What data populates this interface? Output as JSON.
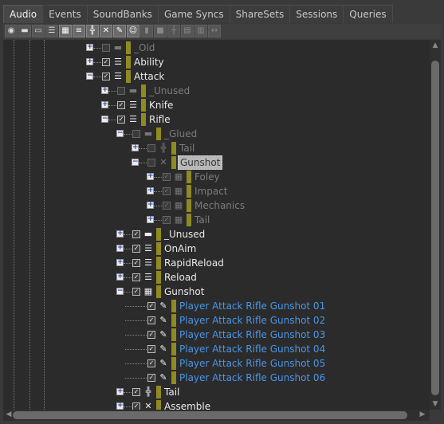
{
  "tabs": [
    {
      "label": "Audio",
      "active": true
    },
    {
      "label": "Events"
    },
    {
      "label": "SoundBanks"
    },
    {
      "label": "Game Syncs"
    },
    {
      "label": "ShareSets"
    },
    {
      "label": "Sessions"
    },
    {
      "label": "Queries"
    }
  ],
  "toolbar": [
    {
      "icon": "work-unit-icon",
      "on": false
    },
    {
      "icon": "folder-icon"
    },
    {
      "icon": "virtual-folder-icon"
    },
    {
      "icon": "actor-mixer-icon"
    },
    {
      "icon": "blend-container-icon",
      "on": true
    },
    {
      "icon": "sequence-container-icon",
      "on": true
    },
    {
      "icon": "switch-container-icon",
      "on": true
    },
    {
      "icon": "random-container-icon",
      "on": true
    },
    {
      "icon": "sound-sfx-icon",
      "on": true
    },
    {
      "icon": "sound-voice-icon",
      "on": true
    },
    {
      "icon": "bus-icon",
      "dim": true
    },
    {
      "icon": "aux-bus-icon",
      "dim": true
    },
    {
      "icon": "music-switch-icon",
      "dim": true
    },
    {
      "icon": "music-playlist-icon",
      "dim": true
    },
    {
      "icon": "music-segment-icon",
      "dim": true
    },
    {
      "icon": "music-track-icon",
      "dim": true
    }
  ],
  "colors": {
    "accent_bar": "#8f8a22",
    "sound_text": "#4a95e8",
    "disabled_text": "#7c7c7c"
  },
  "tree": [
    {
      "level": 0,
      "exp": "+",
      "checked": false,
      "dis": true,
      "icon": "folder-icon",
      "label": "_Old"
    },
    {
      "level": 0,
      "exp": "+",
      "checked": true,
      "icon": "actor-mixer-icon",
      "label": "Ability"
    },
    {
      "level": 0,
      "exp": "-",
      "checked": true,
      "icon": "actor-mixer-icon",
      "label": "Attack"
    },
    {
      "level": 1,
      "exp": "+",
      "checked": false,
      "dis": true,
      "icon": "folder-icon",
      "label": "_Unused"
    },
    {
      "level": 1,
      "exp": "+",
      "checked": true,
      "icon": "actor-mixer-icon",
      "label": "Knife"
    },
    {
      "level": 1,
      "exp": "-",
      "checked": true,
      "icon": "actor-mixer-icon",
      "label": "Rifle"
    },
    {
      "level": 2,
      "exp": "-",
      "checked": false,
      "dis": true,
      "icon": "folder-icon",
      "label": "_Glued"
    },
    {
      "level": 3,
      "exp": "+",
      "checked": false,
      "dis": true,
      "icon": "switch-container-icon",
      "label": "Tail"
    },
    {
      "level": 3,
      "exp": "-",
      "checked": false,
      "dis": true,
      "icon": "random-container-icon",
      "label": "Gunshot",
      "selected": true
    },
    {
      "level": 4,
      "exp": "+",
      "checked": true,
      "dis": true,
      "icon": "blend-container-icon",
      "label": "Foley"
    },
    {
      "level": 4,
      "exp": "+",
      "checked": true,
      "dis": true,
      "icon": "blend-container-icon",
      "label": "Impact"
    },
    {
      "level": 4,
      "exp": "+",
      "checked": true,
      "dis": true,
      "icon": "blend-container-icon",
      "label": "Mechanics"
    },
    {
      "level": 4,
      "exp": "+",
      "checked": true,
      "dis": true,
      "icon": "blend-container-icon",
      "label": "Tail"
    },
    {
      "level": 2,
      "exp": "+",
      "checked": true,
      "icon": "folder-icon",
      "label": "_Unused"
    },
    {
      "level": 2,
      "exp": "+",
      "checked": true,
      "icon": "actor-mixer-icon",
      "label": "OnAim"
    },
    {
      "level": 2,
      "exp": "+",
      "checked": true,
      "icon": "actor-mixer-icon",
      "label": "RapidReload"
    },
    {
      "level": 2,
      "exp": "+",
      "checked": true,
      "icon": "actor-mixer-icon",
      "label": "Reload"
    },
    {
      "level": 2,
      "exp": "-",
      "checked": true,
      "icon": "blend-container-icon",
      "label": "Gunshot"
    },
    {
      "level": 3,
      "checked": true,
      "icon": "sound-sfx-icon",
      "label": "Player Attack Rifle Gunshot 01",
      "blue": true
    },
    {
      "level": 3,
      "checked": true,
      "icon": "sound-sfx-icon",
      "label": "Player Attack Rifle Gunshot 02",
      "blue": true
    },
    {
      "level": 3,
      "checked": true,
      "icon": "sound-sfx-icon",
      "label": "Player Attack Rifle Gunshot 03",
      "blue": true
    },
    {
      "level": 3,
      "checked": true,
      "icon": "sound-sfx-icon",
      "label": "Player Attack Rifle Gunshot 04",
      "blue": true
    },
    {
      "level": 3,
      "checked": true,
      "icon": "sound-sfx-icon",
      "label": "Player Attack Rifle Gunshot 05",
      "blue": true
    },
    {
      "level": 3,
      "checked": true,
      "icon": "sound-sfx-icon",
      "label": "Player Attack Rifle Gunshot 06",
      "blue": true
    },
    {
      "level": 2,
      "exp": "+",
      "checked": true,
      "icon": "switch-container-icon",
      "label": "Tail"
    },
    {
      "level": 2,
      "exp": "+",
      "checked": true,
      "icon": "random-container-icon",
      "label": "Assemble"
    }
  ]
}
